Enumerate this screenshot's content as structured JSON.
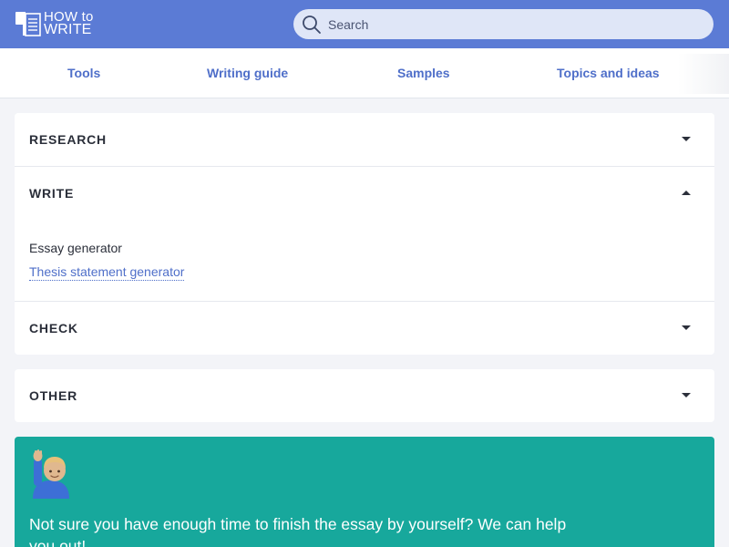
{
  "header": {
    "logo_line1": "HOW to",
    "logo_line2": "WRITE",
    "search_placeholder": "Search"
  },
  "nav": {
    "items": [
      {
        "label": "Tools"
      },
      {
        "label": "Writing guide"
      },
      {
        "label": "Samples"
      },
      {
        "label": "Topics and ideas"
      }
    ]
  },
  "sections": {
    "research": {
      "title": "RESEARCH",
      "state": "collapsed"
    },
    "write": {
      "title": "WRITE",
      "state": "expanded",
      "links": [
        {
          "label": "Essay generator",
          "active": false
        },
        {
          "label": "Thesis statement generator",
          "active": true
        }
      ]
    },
    "check": {
      "title": "CHECK",
      "state": "collapsed"
    },
    "other": {
      "title": "OTHER",
      "state": "collapsed"
    }
  },
  "promo": {
    "emoji": "raising-hand-person",
    "text": "Not sure you have enough time to finish the essay by yourself? We can help you out!"
  },
  "colors": {
    "header_bg": "#5b7bd5",
    "link": "#4f6fc9",
    "promo_bg": "#17a89c"
  }
}
